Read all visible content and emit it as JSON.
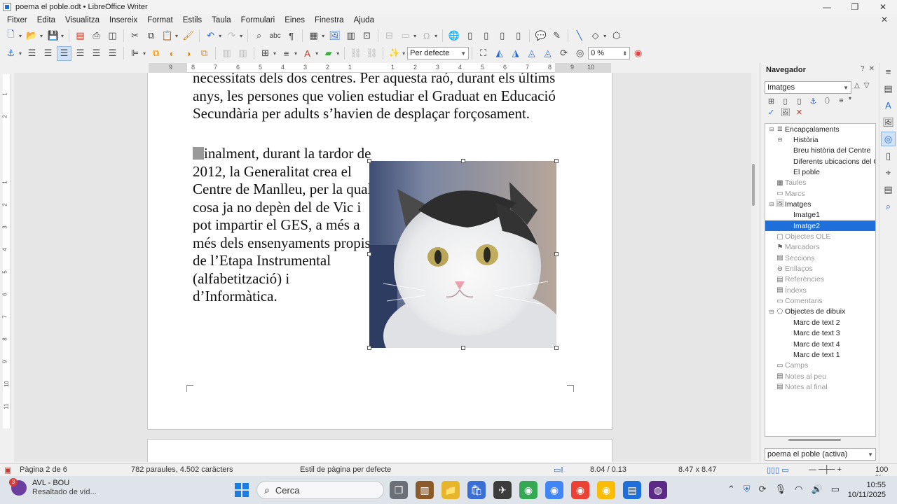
{
  "window": {
    "title": "poema el poble.odt • LibreOffice Writer",
    "minimize": "—",
    "maximize": "❐",
    "close": "✕",
    "close_document": "✕"
  },
  "menu": [
    "Fitxer",
    "Edita",
    "Visualitza",
    "Insereix",
    "Format",
    "Estils",
    "Taula",
    "Formulari",
    "Eines",
    "Finestra",
    "Ajuda"
  ],
  "toolbar": {
    "wrap_style": "Per defecte",
    "transparency": "0 %"
  },
  "ruler": {
    "h_ticks": [
      "9",
      "8",
      "7",
      "6",
      "5",
      "4",
      "3",
      "2",
      "1",
      "1",
      "2",
      "3",
      "4",
      "5",
      "6",
      "7",
      "8",
      "9",
      "10"
    ],
    "v_ticks": [
      "1",
      "2",
      "1",
      "2",
      "3",
      "4",
      "5",
      "6",
      "7",
      "8",
      "9",
      "10",
      "11"
    ]
  },
  "document": {
    "para1": "necessitats dels dos centres. Per aquesta raó, durant els últims anys, les persones que volien estudiar el Graduat en Educació Secundària per adults s’havien de desplaçar forçosament.",
    "para2_first": "inalment, durant la tardor de 2012, la Generalitat crea el Centre de Manlleu, per la qual cosa ja no depèn del de Vic i pot impartir el GES, a més a més dels ensenyaments propis de l’Etapa Instrumental (alfabetització) i d’Informàtica."
  },
  "navigator": {
    "title": "Navegador",
    "help": "?",
    "close": "✕",
    "menu": "≡",
    "content_type": "Imatges",
    "active_document": "poema el poble (activa)",
    "tree": [
      {
        "label": "Encapçalaments",
        "level": 0,
        "expander": "⊟",
        "icon": "≣",
        "disabled": false
      },
      {
        "label": "Història",
        "level": 1,
        "expander": "⊟",
        "icon": "",
        "disabled": false
      },
      {
        "label": "Breu història del Centre",
        "level": 2,
        "expander": "",
        "icon": "",
        "disabled": false
      },
      {
        "label": "Diferents ubicacions del C",
        "level": 2,
        "expander": "",
        "icon": "",
        "disabled": false
      },
      {
        "label": "El poble",
        "level": 1,
        "expander": "",
        "icon": "",
        "disabled": false
      },
      {
        "label": "Taules",
        "level": 0,
        "expander": "",
        "icon": "▦",
        "disabled": true
      },
      {
        "label": "Marcs",
        "level": 0,
        "expander": "",
        "icon": "▭",
        "disabled": true
      },
      {
        "label": "Imatges",
        "level": 0,
        "expander": "⊟",
        "icon": "🖼",
        "disabled": false
      },
      {
        "label": "Imatge1",
        "level": 1,
        "expander": "",
        "icon": "",
        "disabled": false
      },
      {
        "label": "Imatge2",
        "level": 1,
        "expander": "",
        "icon": "",
        "disabled": false,
        "selected": true
      },
      {
        "label": "Objectes OLE",
        "level": 0,
        "expander": "",
        "icon": "▢",
        "disabled": true
      },
      {
        "label": "Marcadors",
        "level": 0,
        "expander": "",
        "icon": "⚑",
        "disabled": true
      },
      {
        "label": "Seccions",
        "level": 0,
        "expander": "",
        "icon": "▤",
        "disabled": true
      },
      {
        "label": "Enllaços",
        "level": 0,
        "expander": "",
        "icon": "⊖",
        "disabled": true
      },
      {
        "label": "Referències",
        "level": 0,
        "expander": "",
        "icon": "▤",
        "disabled": true
      },
      {
        "label": "Índexs",
        "level": 0,
        "expander": "",
        "icon": "▤",
        "disabled": true
      },
      {
        "label": "Comentaris",
        "level": 0,
        "expander": "",
        "icon": "▭",
        "disabled": true
      },
      {
        "label": "Objectes de dibuix",
        "level": 0,
        "expander": "⊟",
        "icon": "⬠",
        "disabled": false
      },
      {
        "label": "Marc de text 2",
        "level": 1,
        "expander": "",
        "icon": "",
        "disabled": false
      },
      {
        "label": "Marc de text 3",
        "level": 1,
        "expander": "",
        "icon": "",
        "disabled": false
      },
      {
        "label": "Marc de text 4",
        "level": 1,
        "expander": "",
        "icon": "",
        "disabled": false
      },
      {
        "label": "Marc de text 1",
        "level": 1,
        "expander": "",
        "icon": "",
        "disabled": false
      },
      {
        "label": "Camps",
        "level": 0,
        "expander": "",
        "icon": "▭",
        "disabled": true
      },
      {
        "label": "Notes al peu",
        "level": 0,
        "expander": "",
        "icon": "▤",
        "disabled": true
      },
      {
        "label": "Notes al final",
        "level": 0,
        "expander": "",
        "icon": "▤",
        "disabled": true
      }
    ]
  },
  "status": {
    "page": "Pàgina 2 de 6",
    "words": "782 paraules, 4.502 caràcters",
    "page_style": "Estil de pàgina per defecte",
    "position": "8.04 / 0.13",
    "size": "8.47 x 8.47",
    "zoom": "100 %"
  },
  "taskbar": {
    "weather_badge": "3",
    "weather_title": "AVL - BOU",
    "weather_sub": "Resaltado de víd...",
    "search_placeholder": "Cerca",
    "time": "10:55",
    "date": "10/11/2025"
  }
}
